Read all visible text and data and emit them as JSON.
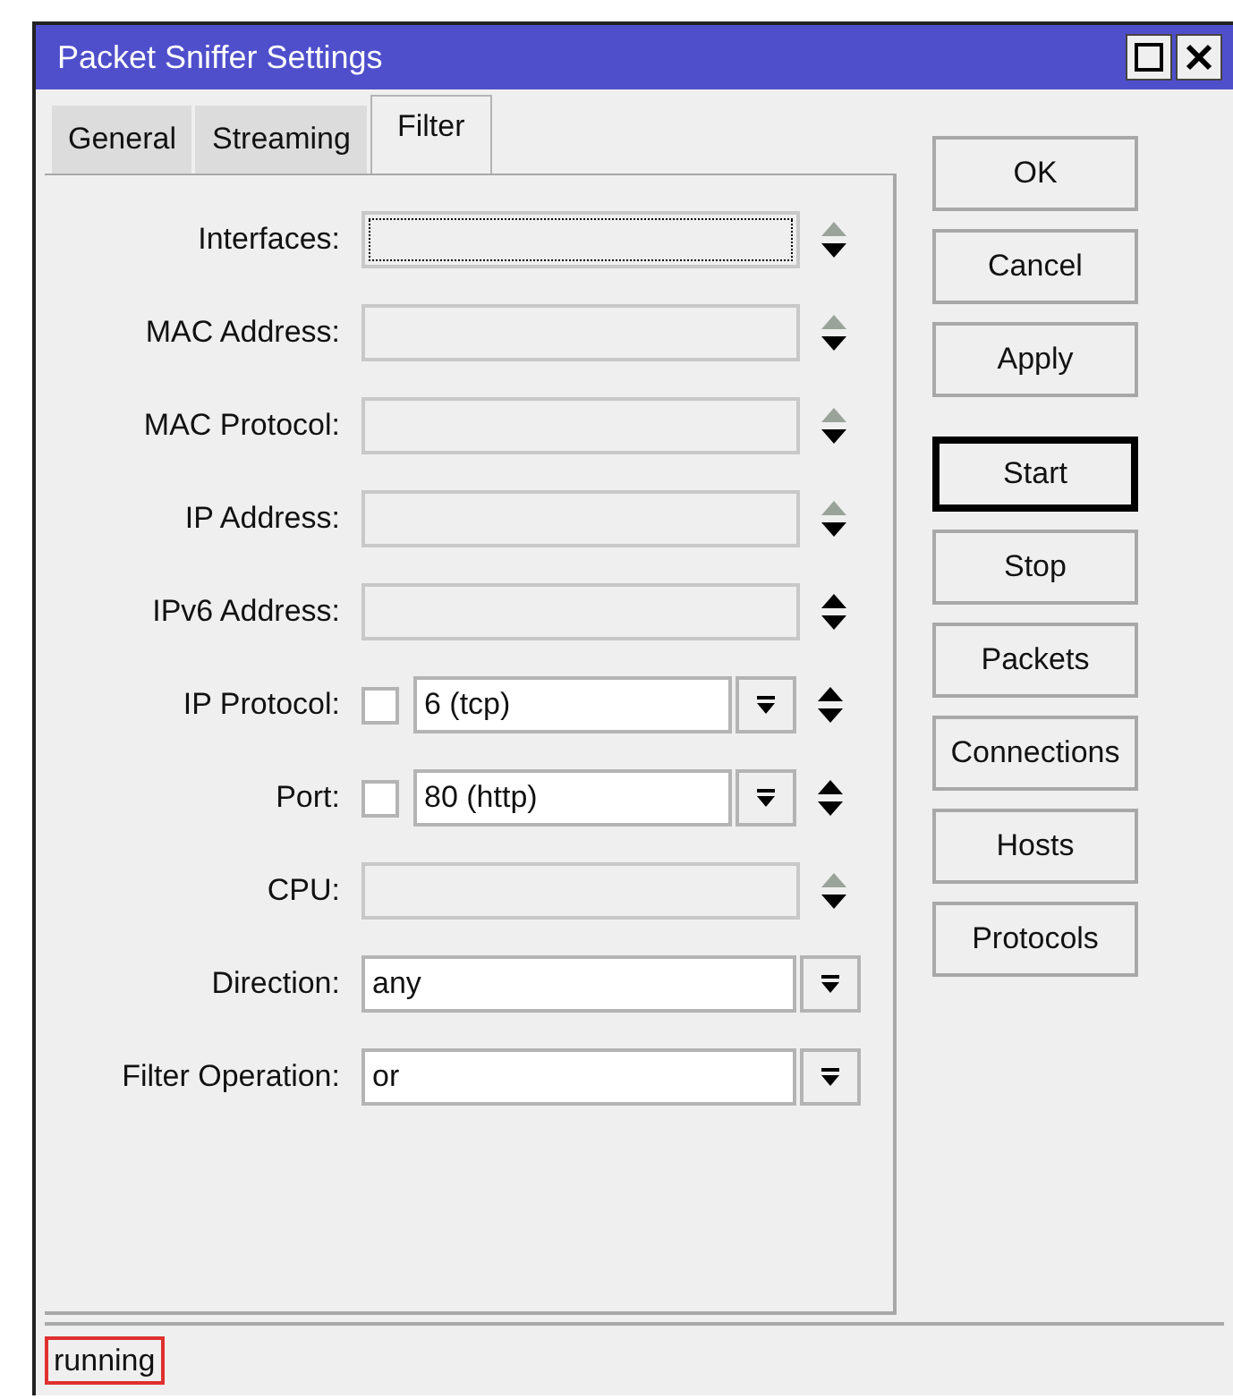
{
  "window": {
    "title": "Packet Sniffer Settings"
  },
  "tabs": [
    {
      "label": "General",
      "selected": false
    },
    {
      "label": "Streaming",
      "selected": false
    },
    {
      "label": "Filter",
      "selected": true
    }
  ],
  "fields": [
    {
      "kind": "text",
      "label": "Interfaces:",
      "focused": true,
      "up_enabled": false
    },
    {
      "kind": "text",
      "label": "MAC Address:",
      "focused": false,
      "up_enabled": false
    },
    {
      "kind": "text",
      "label": "MAC Protocol:",
      "focused": false,
      "up_enabled": false
    },
    {
      "kind": "text",
      "label": "IP Address:",
      "focused": false,
      "up_enabled": false
    },
    {
      "kind": "text",
      "label": "IPv6 Address:",
      "focused": false,
      "up_enabled": true
    },
    {
      "kind": "check_select",
      "label": "IP Protocol:",
      "checked": false,
      "value": "6 (tcp)"
    },
    {
      "kind": "check_select",
      "label": "Port:",
      "checked": false,
      "value": "80 (http)"
    },
    {
      "kind": "text",
      "label": "CPU:",
      "focused": false,
      "up_enabled": false
    },
    {
      "kind": "select",
      "label": "Direction:",
      "value": "any"
    },
    {
      "kind": "select",
      "label": "Filter Operation:",
      "value": "or"
    }
  ],
  "button_groups": [
    [
      {
        "label": "OK",
        "default": false
      },
      {
        "label": "Cancel",
        "default": false
      },
      {
        "label": "Apply",
        "default": false
      }
    ],
    [
      {
        "label": "Start",
        "default": true
      },
      {
        "label": "Stop",
        "default": false
      },
      {
        "label": "Packets",
        "default": false
      },
      {
        "label": "Connections",
        "default": false
      },
      {
        "label": "Hosts",
        "default": false
      },
      {
        "label": "Protocols",
        "default": false
      }
    ]
  ],
  "status_bar": {
    "text": "running"
  }
}
